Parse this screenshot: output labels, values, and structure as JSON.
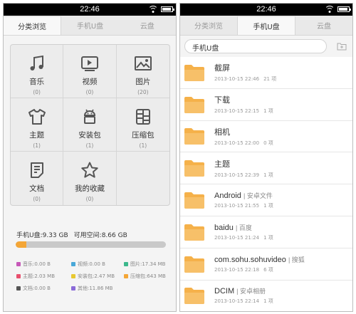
{
  "status": {
    "time": "22:46"
  },
  "left": {
    "tabs": [
      {
        "label": "分类浏览",
        "active": true
      },
      {
        "label": "手机U盘",
        "active": false
      },
      {
        "label": "云盘",
        "active": false
      }
    ],
    "categories": [
      {
        "icon": "music-icon",
        "label": "音乐",
        "count": "(0)"
      },
      {
        "icon": "video-icon",
        "label": "视频",
        "count": "(0)"
      },
      {
        "icon": "picture-icon",
        "label": "图片",
        "count": "(20)"
      },
      {
        "icon": "theme-icon",
        "label": "主题",
        "count": "(1)"
      },
      {
        "icon": "apk-icon",
        "label": "安装包",
        "count": "(1)"
      },
      {
        "icon": "archive-icon",
        "label": "压缩包",
        "count": "(1)"
      },
      {
        "icon": "document-icon",
        "label": "文档",
        "count": "(0)"
      },
      {
        "icon": "favorites-icon",
        "label": "我的收藏",
        "count": "(0)"
      }
    ],
    "storage": {
      "usb": "手机U盘:9.33 GB",
      "free": "可用空间:8.66 GB",
      "used_fraction": 0.07,
      "bar_color": "#f4a637"
    },
    "legend": [
      {
        "label": "音乐:0.00 B",
        "color": "#c658b8"
      },
      {
        "label": "视频:0.00 B",
        "color": "#4aa8d8"
      },
      {
        "label": "图片:17.34 MB",
        "color": "#3cb88c"
      },
      {
        "label": "主题:2.03 MB",
        "color": "#e8506e"
      },
      {
        "label": "安装包:2.47 MB",
        "color": "#e8c830"
      },
      {
        "label": "压缩包:643 MB",
        "color": "#f4a637"
      },
      {
        "label": "文档:0.00 B",
        "color": "#555555"
      },
      {
        "label": "其他:11.86 MB",
        "color": "#8a6ad8"
      }
    ]
  },
  "right": {
    "tabs": [
      {
        "label": "分类浏览",
        "active": false
      },
      {
        "label": "手机U盘",
        "active": true
      },
      {
        "label": "云盘",
        "active": false
      }
    ],
    "path": "手机U盘",
    "folder_color": "#f5b14a",
    "files": [
      {
        "name": "截屏",
        "sub": "",
        "date": "2013-10-15 22:46",
        "count": "21 项"
      },
      {
        "name": "下载",
        "sub": "",
        "date": "2013-10-15 22:15",
        "count": "1 项"
      },
      {
        "name": "相机",
        "sub": "",
        "date": "2013-10-15 22:00",
        "count": "0 项"
      },
      {
        "name": "主题",
        "sub": "",
        "date": "2013-10-15 22:39",
        "count": "1 项"
      },
      {
        "name": "Android",
        "sub": "| 安卓文件",
        "date": "2013-10-15 21:55",
        "count": "1 项"
      },
      {
        "name": "baidu",
        "sub": "| 百度",
        "date": "2013-10-15 21:24",
        "count": "1 项"
      },
      {
        "name": "com.sohu.sohuvideo",
        "sub": "| 搜狐",
        "date": "2013-10-15 22:18",
        "count": "6 项"
      },
      {
        "name": "DCIM",
        "sub": "| 安卓相册",
        "date": "2013-10-15 22:14",
        "count": "1 项"
      }
    ]
  }
}
